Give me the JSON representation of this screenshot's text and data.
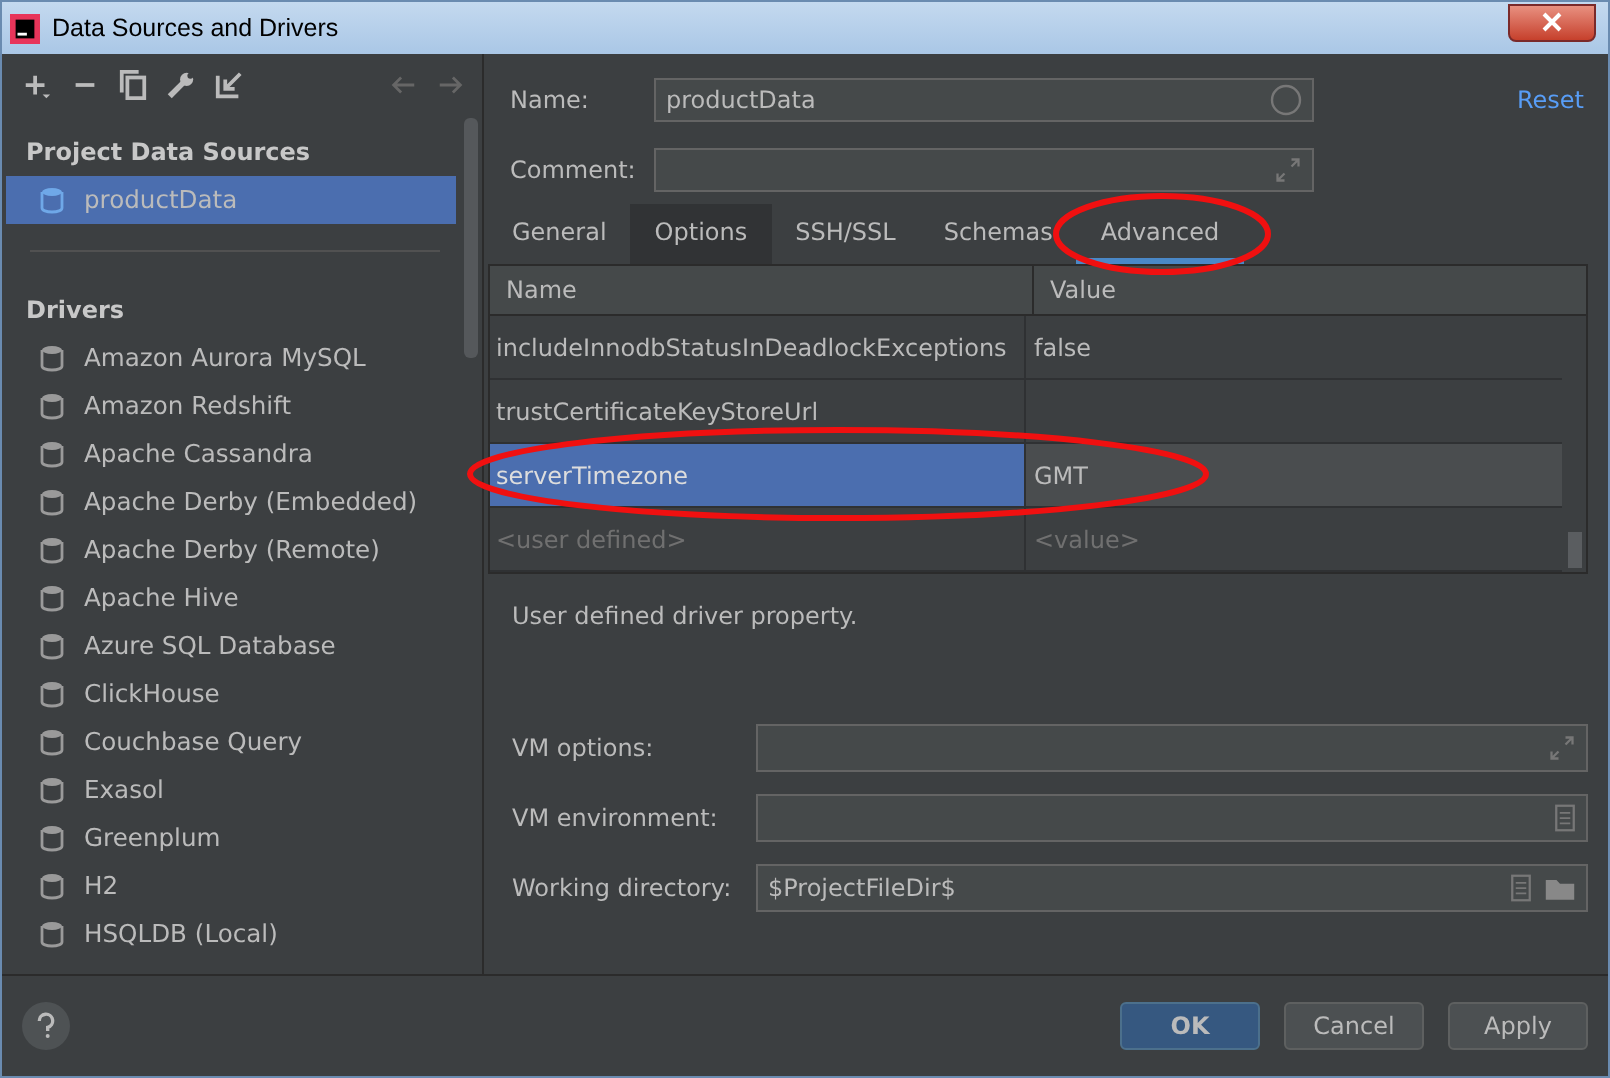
{
  "window": {
    "title": "Data Sources and Drivers"
  },
  "sidebar": {
    "sections": [
      {
        "title": "Project Data Sources",
        "items": [
          {
            "label": "productData",
            "selected": true
          }
        ]
      },
      {
        "title": "Drivers",
        "items": [
          {
            "label": "Amazon Aurora MySQL",
            "selected": false
          },
          {
            "label": "Amazon Redshift",
            "selected": false
          },
          {
            "label": "Apache Cassandra",
            "selected": false
          },
          {
            "label": "Apache Derby (Embedded)",
            "selected": false
          },
          {
            "label": "Apache Derby (Remote)",
            "selected": false
          },
          {
            "label": "Apache Hive",
            "selected": false
          },
          {
            "label": "Azure SQL Database",
            "selected": false
          },
          {
            "label": "ClickHouse",
            "selected": false
          },
          {
            "label": "Couchbase Query",
            "selected": false
          },
          {
            "label": "Exasol",
            "selected": false
          },
          {
            "label": "Greenplum",
            "selected": false
          },
          {
            "label": "H2",
            "selected": false
          },
          {
            "label": "HSQLDB (Local)",
            "selected": false
          }
        ]
      }
    ]
  },
  "form": {
    "name_label": "Name:",
    "name_value": "productData",
    "comment_label": "Comment:",
    "reset": "Reset"
  },
  "tabs": [
    {
      "label": "General",
      "selected": false,
      "hovered": false
    },
    {
      "label": "Options",
      "selected": false,
      "hovered": true
    },
    {
      "label": "SSH/SSL",
      "selected": false,
      "hovered": false
    },
    {
      "label": "Schemas",
      "selected": false,
      "hovered": false
    },
    {
      "label": "Advanced",
      "selected": true,
      "hovered": false
    }
  ],
  "table": {
    "columns": [
      "Name",
      "Value"
    ],
    "rows": [
      {
        "kind": "property",
        "name": "includeInnodbStatusInDeadlockExceptions",
        "value": "false",
        "selected": false
      },
      {
        "kind": "property",
        "name": "trustCertificateKeyStoreUrl",
        "selected": false
      },
      {
        "kind": "property",
        "name": "serverTimezone",
        "value": "GMT",
        "selected": true
      },
      {
        "kind": "placeholder",
        "name": "<user defined>",
        "value": "<value>",
        "selected": false
      }
    ]
  },
  "description": "User defined driver property.",
  "vm": [
    {
      "kind": "expand",
      "label": "VM options:"
    },
    {
      "kind": "document",
      "label": "VM environment:"
    },
    {
      "kind": "folder",
      "label": "Working directory:",
      "value": "$ProjectFileDir$"
    }
  ],
  "buttons": [
    {
      "label": "OK",
      "primary": true
    },
    {
      "label": "Cancel",
      "primary": false
    },
    {
      "label": "Apply",
      "primary": false
    }
  ]
}
